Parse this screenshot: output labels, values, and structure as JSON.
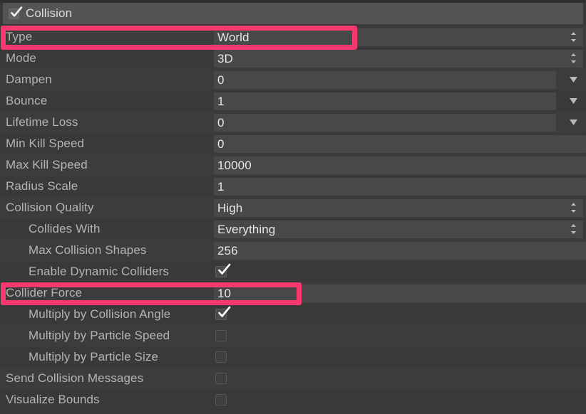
{
  "module": {
    "title": "Collision",
    "enabled_checkbox": "checkbox-checked",
    "enabled": true
  },
  "colors": {
    "highlight": "#f8386f",
    "header_bg": "#545454",
    "row_bg_a": "#3c3c3c",
    "row_bg_b": "#393939",
    "field_bg": "#484848",
    "label_text": "#b4b4b4",
    "value_text": "#e8e8e8"
  },
  "rows": [
    {
      "label": "Type",
      "indent": 0,
      "kind": "popup",
      "value": "World",
      "arrow": "updown-arrows-icon",
      "highlighted": true
    },
    {
      "label": "Mode",
      "indent": 0,
      "kind": "popup",
      "value": "3D",
      "arrow": "updown-arrows-icon",
      "highlighted": false
    },
    {
      "label": "Dampen",
      "indent": 0,
      "kind": "curve",
      "value": "0",
      "arrow": "chevron-down-icon",
      "highlighted": false
    },
    {
      "label": "Bounce",
      "indent": 0,
      "kind": "curve",
      "value": "1",
      "arrow": "chevron-down-icon",
      "highlighted": false
    },
    {
      "label": "Lifetime Loss",
      "indent": 0,
      "kind": "curve",
      "value": "0",
      "arrow": "chevron-down-icon",
      "highlighted": false
    },
    {
      "label": "Min Kill Speed",
      "indent": 0,
      "kind": "number",
      "value": "0",
      "arrow": null,
      "highlighted": false
    },
    {
      "label": "Max Kill Speed",
      "indent": 0,
      "kind": "number",
      "value": "10000",
      "arrow": null,
      "highlighted": false
    },
    {
      "label": "Radius Scale",
      "indent": 0,
      "kind": "number",
      "value": "1",
      "arrow": null,
      "highlighted": false
    },
    {
      "label": "Collision Quality",
      "indent": 0,
      "kind": "popup",
      "value": "High",
      "arrow": "updown-arrows-icon",
      "highlighted": false
    },
    {
      "label": "Collides With",
      "indent": 1,
      "kind": "popup",
      "value": "Everything",
      "arrow": "updown-arrows-icon",
      "highlighted": false
    },
    {
      "label": "Max Collision Shapes",
      "indent": 1,
      "kind": "number",
      "value": "256",
      "arrow": null,
      "highlighted": false
    },
    {
      "label": "Enable Dynamic Colliders",
      "indent": 1,
      "kind": "checkbox",
      "checked": true,
      "arrow": null,
      "highlighted": false
    },
    {
      "label": "Collider Force",
      "indent": 0,
      "kind": "number",
      "value": "10",
      "arrow": null,
      "highlighted": true
    },
    {
      "label": "Multiply by Collision Angle",
      "indent": 1,
      "kind": "checkbox",
      "checked": true,
      "arrow": null,
      "highlighted": false
    },
    {
      "label": "Multiply by Particle Speed",
      "indent": 1,
      "kind": "checkbox",
      "checked": false,
      "arrow": null,
      "highlighted": false
    },
    {
      "label": "Multiply by Particle Size",
      "indent": 1,
      "kind": "checkbox",
      "checked": false,
      "arrow": null,
      "highlighted": false
    },
    {
      "label": "Send Collision Messages",
      "indent": 0,
      "kind": "checkbox",
      "checked": false,
      "arrow": null,
      "highlighted": false
    },
    {
      "label": "Visualize Bounds",
      "indent": 0,
      "kind": "checkbox",
      "checked": false,
      "arrow": null,
      "highlighted": false
    }
  ],
  "annotations": [
    {
      "name": "type-row-highlight",
      "target": "Type"
    },
    {
      "name": "collider-force-row-highlight",
      "target": "Collider Force"
    }
  ]
}
